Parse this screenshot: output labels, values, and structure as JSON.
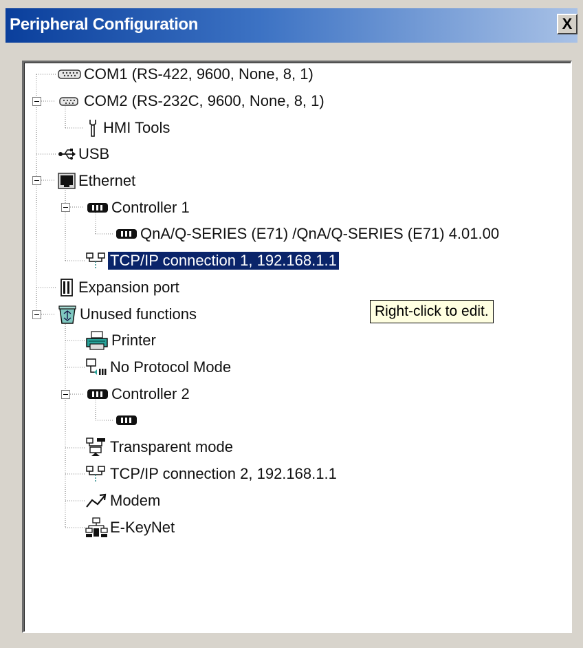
{
  "window": {
    "title": "Peripheral Configuration",
    "close_label": "X"
  },
  "tree": {
    "com1": "COM1 (RS-422, 9600, None, 8, 1)",
    "com2": "COM2 (RS-232C, 9600, None, 8, 1)",
    "hmi_tools": "HMI Tools",
    "usb": "USB",
    "ethernet": "Ethernet",
    "controller1": "Controller 1",
    "qna_series": "QnA/Q-SERIES (E71) /QnA/Q-SERIES (E71) 4.01.00",
    "tcpip1": "TCP/IP connection 1, 192.168.1.1",
    "expansion_port": "Expansion port",
    "unused_functions": "Unused functions",
    "printer": "Printer",
    "no_protocol_mode": "No Protocol Mode",
    "controller2": "Controller 2",
    "transparent_mode": "Transparent mode",
    "tcpip2": "TCP/IP connection 2, 192.168.1.1",
    "modem": "Modem",
    "ekeynet": "E-KeyNet"
  },
  "tooltip": "Right-click to edit.",
  "selected_item": "tcpip1",
  "colors": {
    "selection": "#0a246a",
    "titlebar_start": "#0a3f9c",
    "titlebar_end": "#a8c1e6",
    "tooltip_bg": "#ffffe1"
  },
  "icons": {
    "com1": "serial-port-icon",
    "com2": "serial-port-icon",
    "hmi_tools": "wrench-icon",
    "usb": "usb-icon",
    "ethernet": "ethernet-port-icon",
    "controller": "controller-icon",
    "tcpip": "network-connection-icon",
    "expansion_port": "expansion-port-icon",
    "unused_functions": "recycle-bin-icon",
    "printer": "printer-icon",
    "no_protocol_mode": "no-protocol-icon",
    "transparent_mode": "transparent-mode-icon",
    "modem": "modem-icon",
    "ekeynet": "ekeynet-icon"
  }
}
